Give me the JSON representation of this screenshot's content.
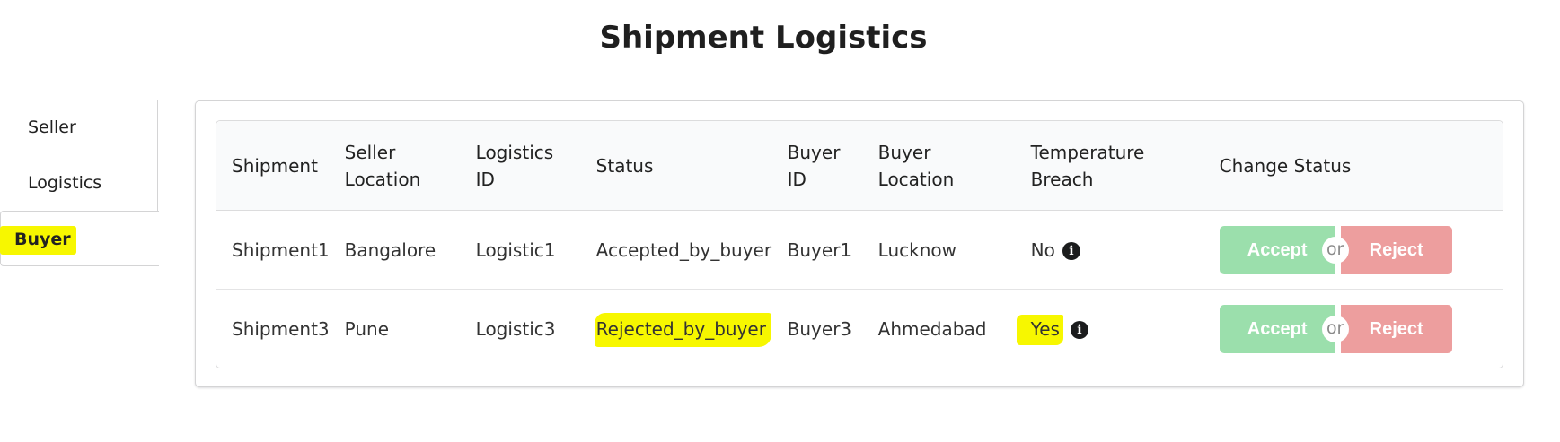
{
  "page": {
    "title": "Shipment Logistics"
  },
  "sidebar": {
    "items": [
      {
        "label": "Seller"
      },
      {
        "label": "Logistics"
      },
      {
        "label": "Buyer"
      }
    ]
  },
  "table": {
    "headers": {
      "shipment": "Shipment",
      "seller_location_1": "Seller",
      "seller_location_2": "Location",
      "logistics_id_1": "Logistics",
      "logistics_id_2": "ID",
      "status": "Status",
      "buyer_id_1": "Buyer",
      "buyer_id_2": "ID",
      "buyer_location_1": "Buyer",
      "buyer_location_2": "Location",
      "temperature_breach_1": "Temperature",
      "temperature_breach_2": "Breach",
      "change_status": "Change Status"
    },
    "rows": [
      {
        "shipment": "Shipment1",
        "seller_location": "Bangalore",
        "logistics_id": "Logistic1",
        "status": "Accepted_by_buyer",
        "buyer_id": "Buyer1",
        "buyer_location": "Lucknow",
        "temperature_breach": "No"
      },
      {
        "shipment": "Shipment3",
        "seller_location": "Pune",
        "logistics_id": "Logistic3",
        "status": "Rejected_by_buyer",
        "buyer_id": "Buyer3",
        "buyer_location": "Ahmedabad",
        "temperature_breach": "Yes"
      }
    ]
  },
  "actions": {
    "accept_label": "Accept",
    "or_label": "or",
    "reject_label": "Reject",
    "info_glyph": "i"
  },
  "colors": {
    "accept": "#9bdfac",
    "reject": "#ed9e9e",
    "highlight": "#f7f700"
  }
}
